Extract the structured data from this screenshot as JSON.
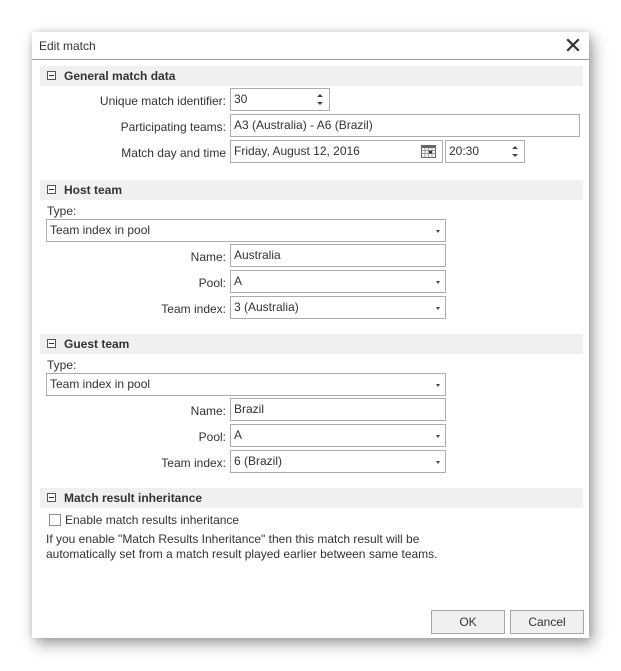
{
  "window": {
    "title": "Edit match",
    "close_icon": "close-icon"
  },
  "general": {
    "title": "General match data",
    "identifier_label": "Unique match identifier:",
    "identifier_value": "30",
    "teams_label": "Participating teams:",
    "teams_value": "A3 (Australia) - A6 (Brazil)",
    "datetime_label": "Match day and time",
    "date_value": "Friday, August 12, 2016",
    "time_value": "20:30"
  },
  "host": {
    "title": "Host team",
    "type_label": "Type:",
    "type_value": "Team index in pool",
    "name_label": "Name:",
    "name_value": "Australia",
    "pool_label": "Pool:",
    "pool_value": "A",
    "index_label": "Team index:",
    "index_value": "3 (Australia)"
  },
  "guest": {
    "title": "Guest team",
    "type_label": "Type:",
    "type_value": "Team index in pool",
    "name_label": "Name:",
    "name_value": "Brazil",
    "pool_label": "Pool:",
    "pool_value": "A",
    "index_label": "Team index:",
    "index_value": "6 (Brazil)"
  },
  "inheritance": {
    "title": "Match result inheritance",
    "checkbox_label": "Enable match results inheritance",
    "checked": false,
    "info_line1": "If you enable \"Match Results Inheritance\" then this match result will be",
    "info_line2": "automatically set from a match result played earlier between same teams."
  },
  "buttons": {
    "ok": "OK",
    "cancel": "Cancel"
  }
}
